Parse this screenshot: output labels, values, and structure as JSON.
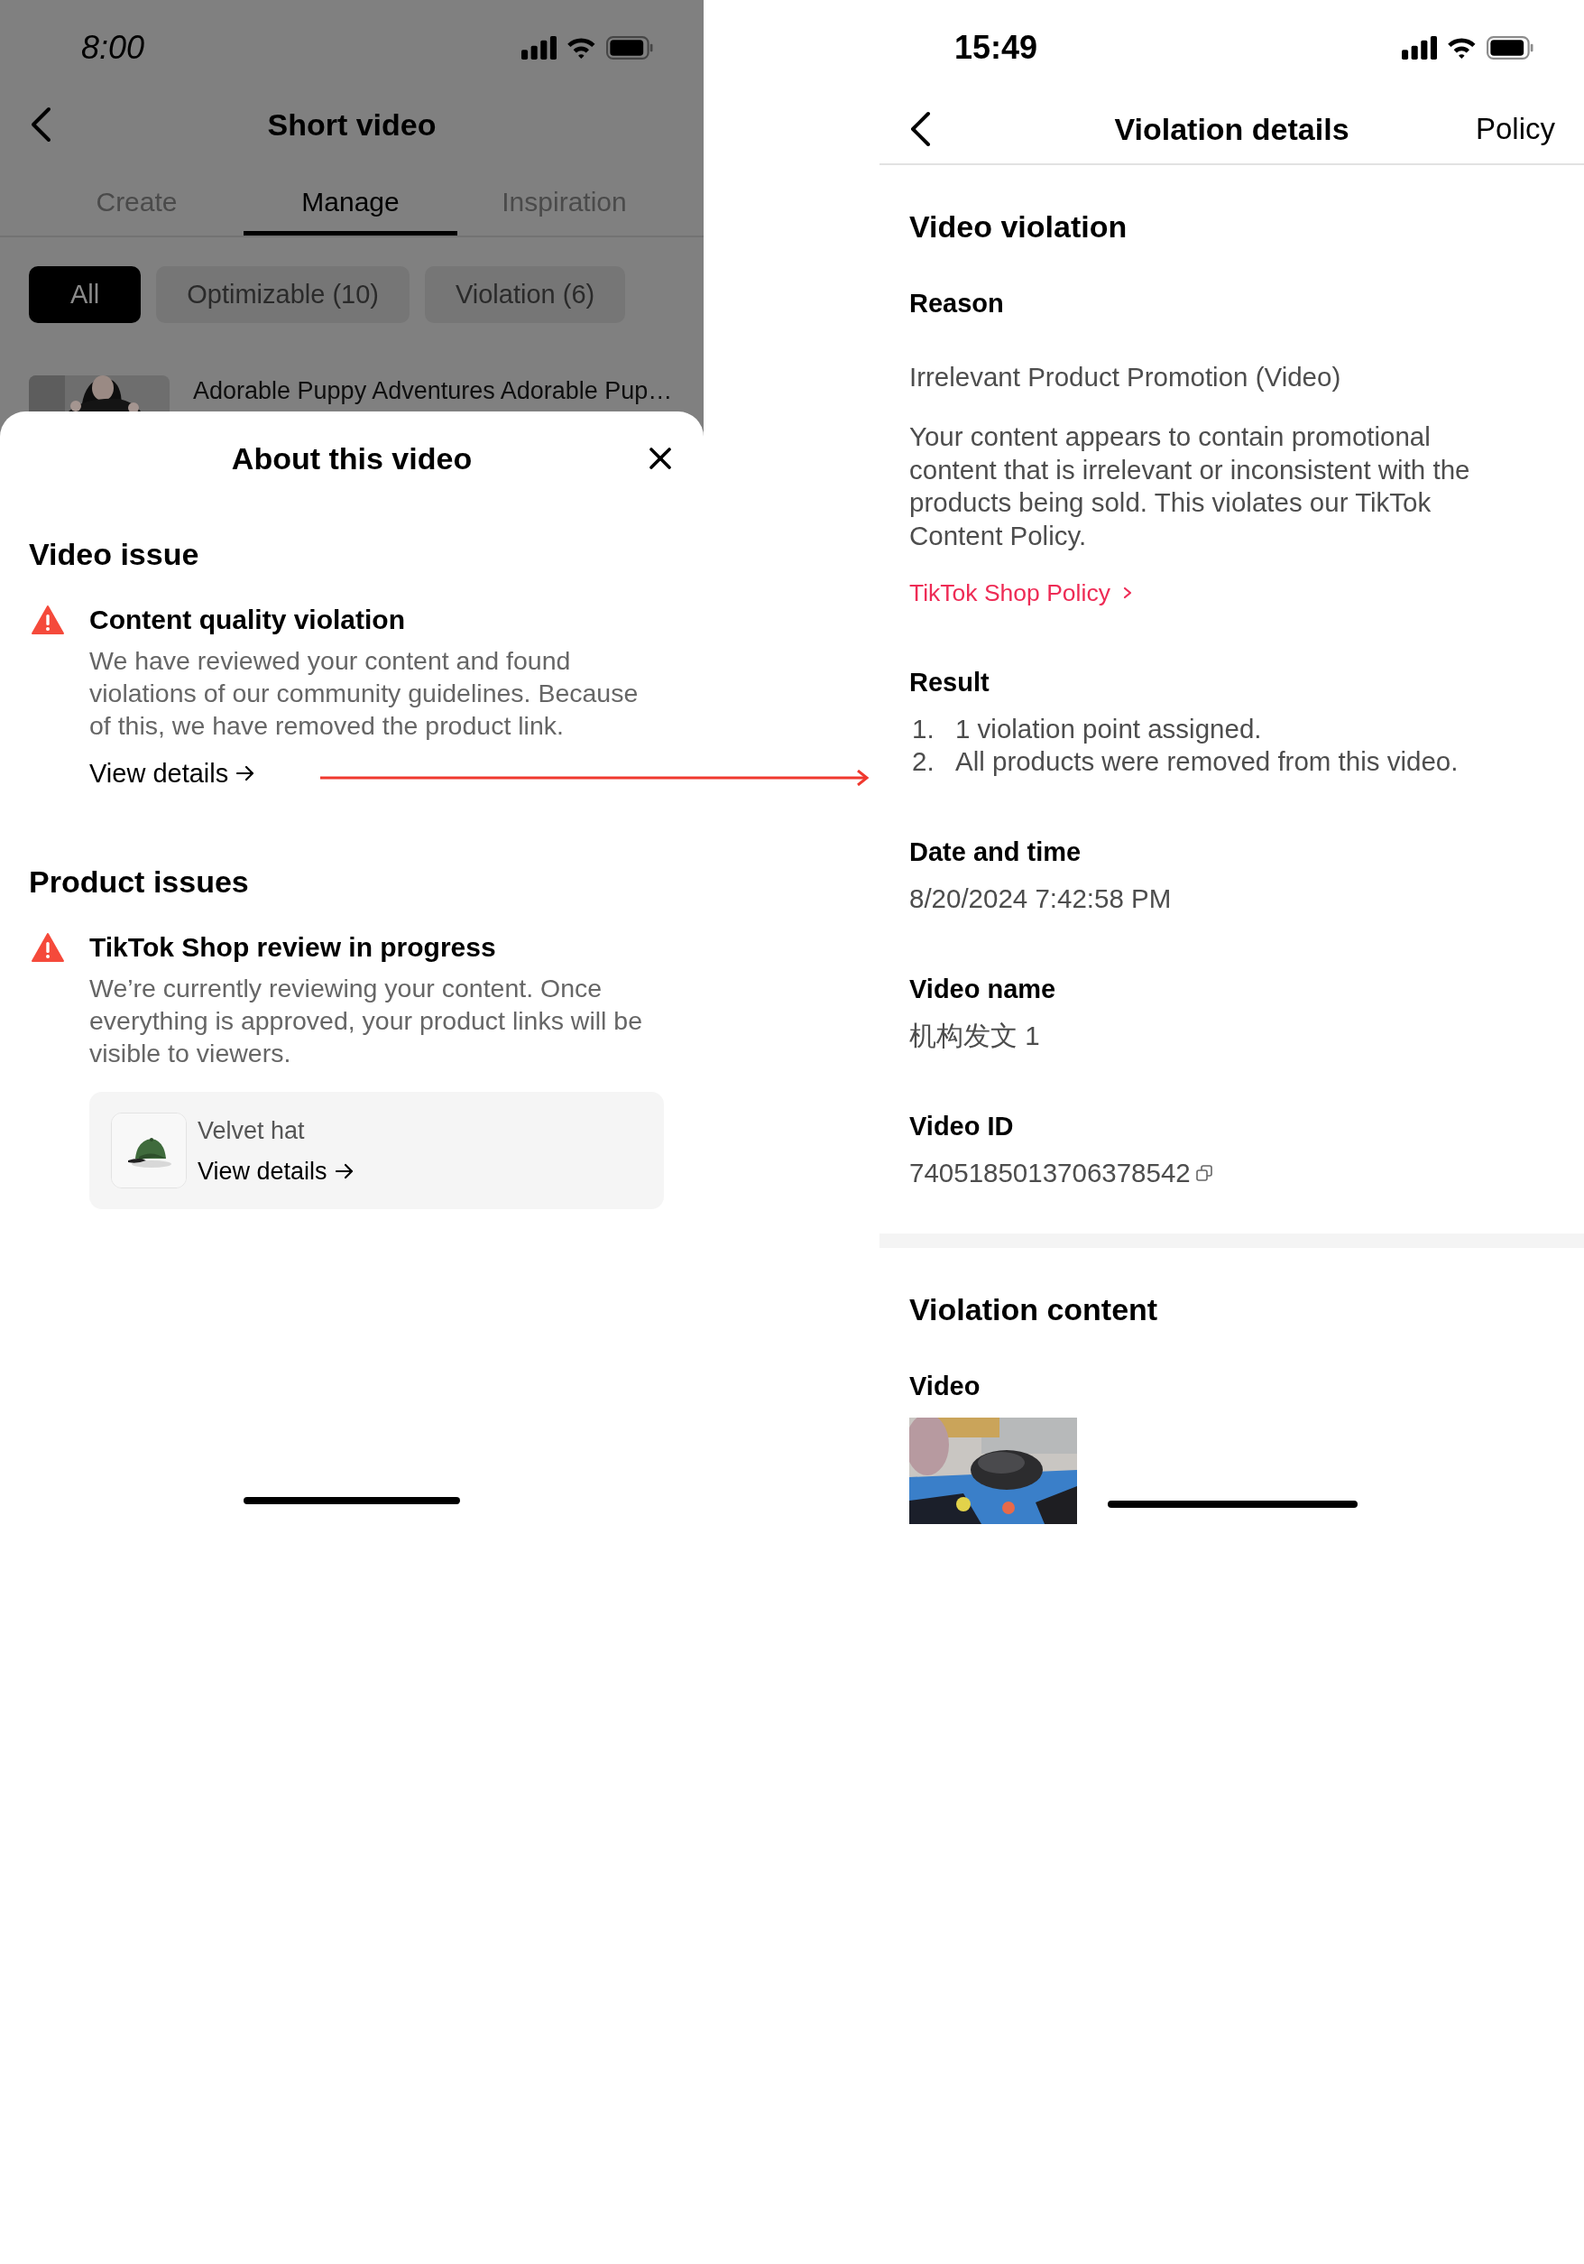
{
  "left_screen": {
    "status_bar": {
      "time": "8:00"
    },
    "nav": {
      "title": "Short video"
    },
    "tabs": [
      {
        "label": "Create",
        "selected": false
      },
      {
        "label": "Manage",
        "selected": true
      },
      {
        "label": "Inspiration",
        "selected": false
      }
    ],
    "filters": [
      {
        "label": "All",
        "selected": true
      },
      {
        "label": "Optimizable (10)",
        "selected": false
      },
      {
        "label": "Violation (6)",
        "selected": false
      }
    ],
    "video_row": {
      "title": "Adorable Puppy Adventures Adorable Pup…"
    },
    "sheet": {
      "title": "About this video",
      "sections": [
        {
          "heading": "Video issue",
          "issues": [
            {
              "title": "Content quality violation",
              "body": "We have reviewed your content and found violations of our community guidelines. Because of this, we have removed the product link.",
              "link": "View details"
            }
          ]
        },
        {
          "heading": "Product issues",
          "issues": [
            {
              "title": "TikTok Shop review in progress",
              "body": "We’re currently reviewing your content. Once everything is approved, your product links will be visible to viewers.",
              "products": [
                {
                  "name": "Velvet hat",
                  "link": "View details"
                }
              ]
            }
          ]
        }
      ]
    }
  },
  "right_screen": {
    "status_bar": {
      "time": "15:49"
    },
    "nav": {
      "title": "Violation details",
      "action": "Policy"
    },
    "sections": [
      {
        "heading": "Video violation",
        "reason": {
          "label": "Reason",
          "value": "Irrelevant Product Promotion (Video)",
          "description": "Your content appears to contain promotional content that is irrelevant or inconsistent with the products being sold. This violates our TikTok Content Policy.",
          "link": "TikTok Shop Policy"
        },
        "result": {
          "label": "Result",
          "items": [
            {
              "number": "1.",
              "text": "1 violation point assigned."
            },
            {
              "number": "2.",
              "text": "All products were removed from this video."
            }
          ]
        },
        "fields": [
          {
            "label": "Date and time",
            "value": "8/20/2024 7:42:58 PM",
            "copyable": false
          },
          {
            "label": "Video name",
            "value": "机构发文 1",
            "copyable": false
          },
          {
            "label": "Video ID",
            "value": "7405185013706378542",
            "copyable": true
          }
        ]
      },
      {
        "heading": "Violation content",
        "media": [
          {
            "label": "Video",
            "kind": "picture"
          }
        ]
      }
    ]
  }
}
